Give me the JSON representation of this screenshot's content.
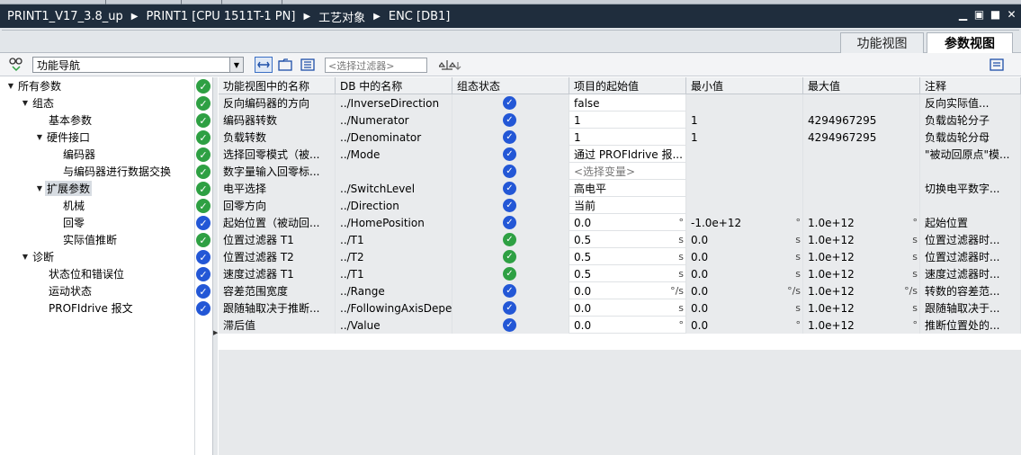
{
  "titlebar": {
    "breadcrumb": [
      "PRINT1_V17_3.8_up",
      "PRINT1 [CPU 1511T-1 PN]",
      "工艺对象",
      "ENC [DB1]"
    ],
    "separator": "▶"
  },
  "window_controls": [
    "minimize-icon",
    "restore-icon",
    "maximize-icon",
    "close-icon"
  ],
  "view_tabs": {
    "function_view": "功能视图",
    "parameter_view": "参数视图",
    "active": "参数视图"
  },
  "toolbar": {
    "navigation_select": "功能导航",
    "filter_placeholder": "<选择过滤器>"
  },
  "tree": [
    {
      "label": "所有参数",
      "level": 0,
      "expanded": true,
      "status": "green"
    },
    {
      "label": "组态",
      "level": 1,
      "expanded": true,
      "status": "green"
    },
    {
      "label": "基本参数",
      "level": 2,
      "status": "green"
    },
    {
      "label": "硬件接口",
      "level": 2,
      "expanded": true,
      "status": "green"
    },
    {
      "label": "编码器",
      "level": 3,
      "status": "green"
    },
    {
      "label": "与编码器进行数据交换",
      "level": 3,
      "status": "green"
    },
    {
      "label": "扩展参数",
      "level": 2,
      "expanded": true,
      "status": "green",
      "selected": true
    },
    {
      "label": "机械",
      "level": 3,
      "status": "green"
    },
    {
      "label": "回零",
      "level": 3,
      "status": "blue"
    },
    {
      "label": "实际值推断",
      "level": 3,
      "status": "green"
    },
    {
      "label": "诊断",
      "level": 1,
      "expanded": true,
      "status": "blue"
    },
    {
      "label": "状态位和错误位",
      "level": 2,
      "status": "blue"
    },
    {
      "label": "运动状态",
      "level": 2,
      "status": "blue"
    },
    {
      "label": "PROFIdrive 报文",
      "level": 2,
      "status": "blue"
    }
  ],
  "grid": {
    "headers": [
      "功能视图中的名称",
      "DB 中的名称",
      "组态状态",
      "项目的起始值",
      "最小值",
      "最大值",
      "注释"
    ],
    "rows": [
      {
        "name": "反向编码器的方向",
        "db": "../InverseDirection",
        "status": "blue",
        "start": "false",
        "start_unit": "",
        "min": "",
        "min_unit": "",
        "max": "",
        "max_unit": "",
        "comment": "反向实际值..."
      },
      {
        "name": "编码器转数",
        "db": "../Numerator",
        "status": "blue",
        "start": "1",
        "start_unit": "",
        "min": "1",
        "min_unit": "",
        "max": "4294967295",
        "max_unit": "",
        "comment": "负载齿轮分子"
      },
      {
        "name": "负载转数",
        "db": "../Denominator",
        "status": "blue",
        "start": "1",
        "start_unit": "",
        "min": "1",
        "min_unit": "",
        "max": "4294967295",
        "max_unit": "",
        "comment": "负载齿轮分母"
      },
      {
        "name": "选择回零模式（被...",
        "db": "../Mode",
        "status": "blue",
        "start": "通过 PROFIdrive 报...",
        "start_unit": "",
        "min": "",
        "min_unit": "",
        "max": "",
        "max_unit": "",
        "comment": "\"被动回原点\"模..."
      },
      {
        "name": "数字量输入回零标...",
        "db": "",
        "status": "blue",
        "start": "<选择变量>",
        "start_unit": "",
        "min": "",
        "min_unit": "",
        "max": "",
        "max_unit": "",
        "comment": "",
        "start_dim": true
      },
      {
        "name": "电平选择",
        "db": "../SwitchLevel",
        "status": "blue",
        "start": "高电平",
        "start_unit": "",
        "min": "",
        "min_unit": "",
        "max": "",
        "max_unit": "",
        "comment": "切换电平数字..."
      },
      {
        "name": "回零方向",
        "db": "../Direction",
        "status": "blue",
        "start": "当前",
        "start_unit": "",
        "min": "",
        "min_unit": "",
        "max": "",
        "max_unit": "",
        "comment": ""
      },
      {
        "name": "起始位置（被动回...",
        "db": "../HomePosition",
        "status": "blue",
        "start": "0.0",
        "start_unit": "°",
        "min": "-1.0e+12",
        "min_unit": "°",
        "max": "1.0e+12",
        "max_unit": "°",
        "comment": "起始位置"
      },
      {
        "name": "位置过滤器 T1",
        "db": "../T1",
        "status": "green",
        "start": "0.5",
        "start_unit": "s",
        "min": "0.0",
        "min_unit": "s",
        "max": "1.0e+12",
        "max_unit": "s",
        "comment": "位置过滤器时..."
      },
      {
        "name": "位置过滤器 T2",
        "db": "../T2",
        "status": "green",
        "start": "0.5",
        "start_unit": "s",
        "min": "0.0",
        "min_unit": "s",
        "max": "1.0e+12",
        "max_unit": "s",
        "comment": "位置过滤器时..."
      },
      {
        "name": "速度过滤器 T1",
        "db": "../T1",
        "status": "green",
        "start": "0.5",
        "start_unit": "s",
        "min": "0.0",
        "min_unit": "s",
        "max": "1.0e+12",
        "max_unit": "s",
        "comment": "速度过滤器时..."
      },
      {
        "name": "容差范围宽度",
        "db": "../Range",
        "status": "blue",
        "start": "0.0",
        "start_unit": "°/s",
        "min": "0.0",
        "min_unit": "°/s",
        "max": "1.0e+12",
        "max_unit": "°/s",
        "comment": "转数的容差范..."
      },
      {
        "name": "跟随轴取决于推断...",
        "db": "../FollowingAxisDepe...",
        "status": "blue",
        "start": "0.0",
        "start_unit": "s",
        "min": "0.0",
        "min_unit": "s",
        "max": "1.0e+12",
        "max_unit": "s",
        "comment": "跟随轴取决于..."
      },
      {
        "name": "滞后值",
        "db": "../Value",
        "status": "blue",
        "start": "0.0",
        "start_unit": "°",
        "min": "0.0",
        "min_unit": "°",
        "max": "1.0e+12",
        "max_unit": "°",
        "comment": "推断位置处的..."
      }
    ]
  },
  "colors": {
    "title_bg": "#1f2d3d",
    "status_green": "#2ea043",
    "status_blue": "#2357d6"
  }
}
